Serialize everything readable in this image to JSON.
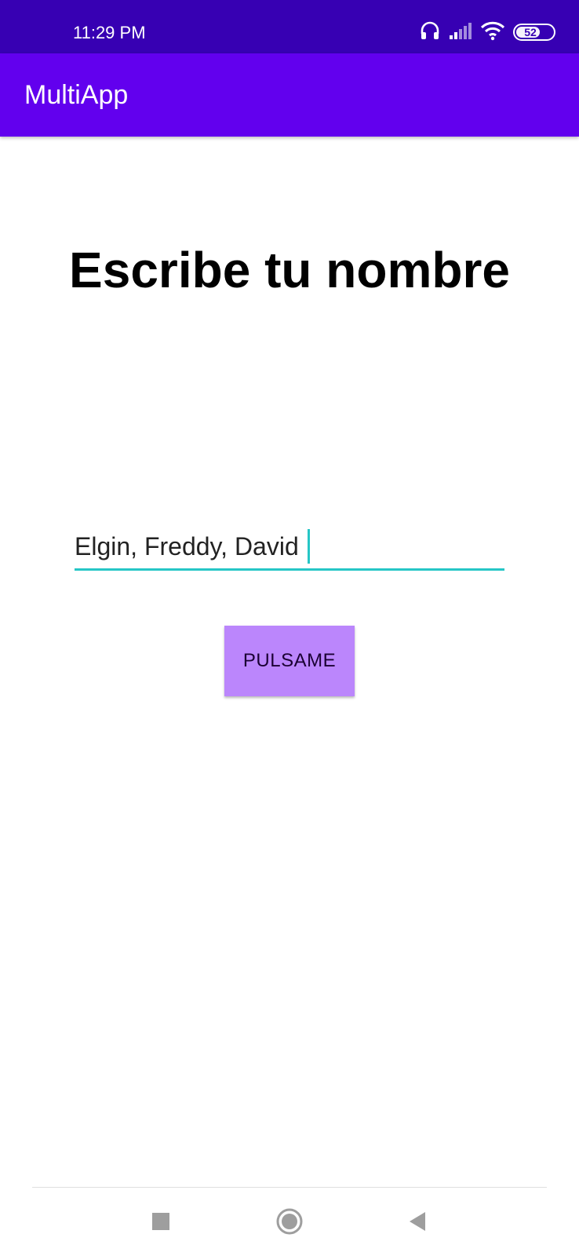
{
  "status_bar": {
    "time": "11:29 PM",
    "battery_level": "52",
    "icons": [
      "headphones-icon",
      "signal-icon",
      "wifi-icon",
      "battery-icon"
    ]
  },
  "app_bar": {
    "title": "MultiApp"
  },
  "main": {
    "heading": "Escribe tu nombre",
    "name_input": {
      "value": "Elgin, Freddy, David"
    },
    "button_label": "PULSAME"
  },
  "nav_bar": {
    "icons": [
      "recents-icon",
      "home-icon",
      "back-icon"
    ]
  },
  "colors": {
    "status_bar": "#3700b3",
    "app_bar": "#6200ee",
    "button": "#bb86fc",
    "input_accent": "#26c6c6"
  }
}
